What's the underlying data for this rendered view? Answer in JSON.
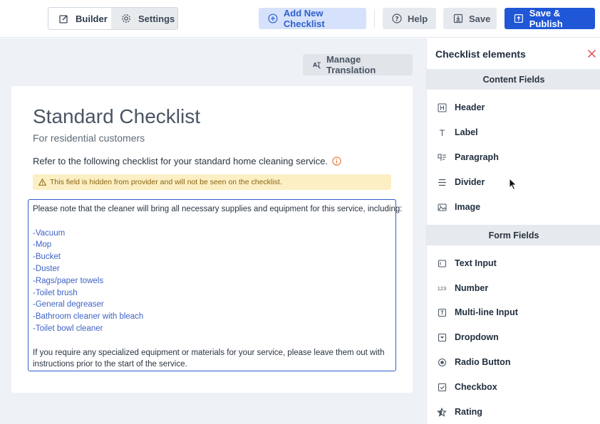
{
  "toolbar": {
    "tabs": [
      {
        "label": "Builder",
        "icon": "edit-icon",
        "active": true
      },
      {
        "label": "Settings",
        "icon": "gear-icon",
        "active": false
      }
    ],
    "add_label": "Add New Checklist",
    "help_label": "Help",
    "save_label": "Save",
    "publish_label": "Save & Publish"
  },
  "main": {
    "manage_translation_label": "Manage Translation",
    "title": "Standard Checklist",
    "subtitle": "For residential customers",
    "description": "Refer to the following checklist for your standard home cleaning service.",
    "warning": "This field is hidden from provider and will not be seen on the checklist.",
    "text_intro": "Please note that the cleaner will bring all necessary supplies and equipment for this service, including:",
    "text_items": [
      "-Vacuum",
      "-Mop",
      "-Bucket",
      "-Duster",
      "-Rags/paper towels",
      "-Toilet brush",
      "-General degreaser",
      "-Bathroom cleaner with bleach",
      "-Toilet bowl cleaner"
    ],
    "text_outro": "If you require any specialized equipment or materials for your service, please leave them out with instructions prior to the start of the service."
  },
  "panel": {
    "title": "Checklist elements",
    "content_section": "Content Fields",
    "content_items": [
      {
        "label": "Header",
        "icon": "header-icon"
      },
      {
        "label": "Label",
        "icon": "text-icon"
      },
      {
        "label": "Paragraph",
        "icon": "paragraph-icon"
      },
      {
        "label": "Divider",
        "icon": "divider-icon"
      },
      {
        "label": "Image",
        "icon": "image-icon"
      }
    ],
    "form_section": "Form Fields",
    "form_items": [
      {
        "label": "Text Input",
        "icon": "text-input-icon"
      },
      {
        "label": "Number",
        "icon": "number-icon",
        "glyph": "123"
      },
      {
        "label": "Multi-line Input",
        "icon": "multiline-icon"
      },
      {
        "label": "Dropdown",
        "icon": "dropdown-icon"
      },
      {
        "label": "Radio Button",
        "icon": "radio-icon"
      },
      {
        "label": "Checkbox",
        "icon": "checkbox-icon"
      },
      {
        "label": "Rating",
        "icon": "star-icon"
      }
    ]
  },
  "colors": {
    "primary": "#1f57d6",
    "accent_light": "#d6e2fb",
    "warning_bg": "#fcefc4",
    "close_red": "#e5484d"
  }
}
